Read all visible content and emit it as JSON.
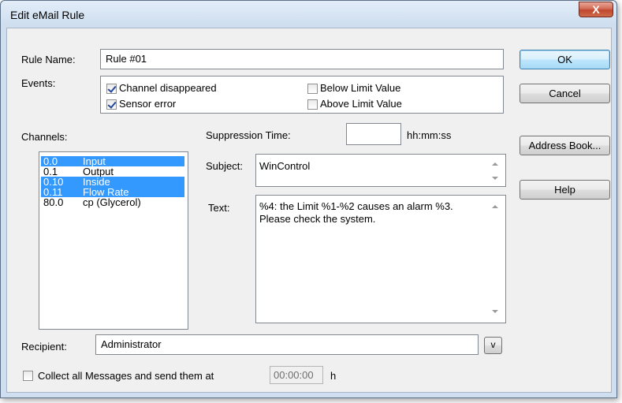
{
  "window": {
    "title": "Edit eMail Rule",
    "close_label": "X"
  },
  "rule_name": {
    "label": "Rule Name:",
    "value": "Rule #01"
  },
  "events": {
    "label": "Events:",
    "items": [
      {
        "label": "Channel disappeared",
        "checked": true
      },
      {
        "label": "Sensor error",
        "checked": true
      },
      {
        "label": "Below Limit Value",
        "checked": false
      },
      {
        "label": "Above Limit Value",
        "checked": false
      }
    ]
  },
  "channels": {
    "label": "Channels:",
    "items": [
      {
        "num": "0.0",
        "name": "Input",
        "selected": true
      },
      {
        "num": "0.1",
        "name": "Output",
        "selected": false
      },
      {
        "num": "0.10",
        "name": "Inside",
        "selected": true
      },
      {
        "num": "0.11",
        "name": "Flow Rate",
        "selected": true
      },
      {
        "num": "80.0",
        "name": "cp (Glycerol)",
        "selected": false
      }
    ]
  },
  "suppression": {
    "label": "Suppression Time:",
    "value": "",
    "unit": "hh:mm:ss"
  },
  "subject": {
    "label": "Subject:",
    "value": "WinControl"
  },
  "text": {
    "label": "Text:",
    "line1": "%4: the Limit %1-%2 causes an alarm %3.",
    "line2": "Please check the system."
  },
  "recipient": {
    "label": "Recipient:",
    "value": "Administrator",
    "dropdown_label": "v"
  },
  "collect": {
    "label": "Collect all Messages and send them at",
    "checked": false,
    "time": "00:00:00",
    "unit": "h"
  },
  "buttons": {
    "ok": "OK",
    "cancel": "Cancel",
    "address_book": "Address Book...",
    "help": "Help"
  }
}
